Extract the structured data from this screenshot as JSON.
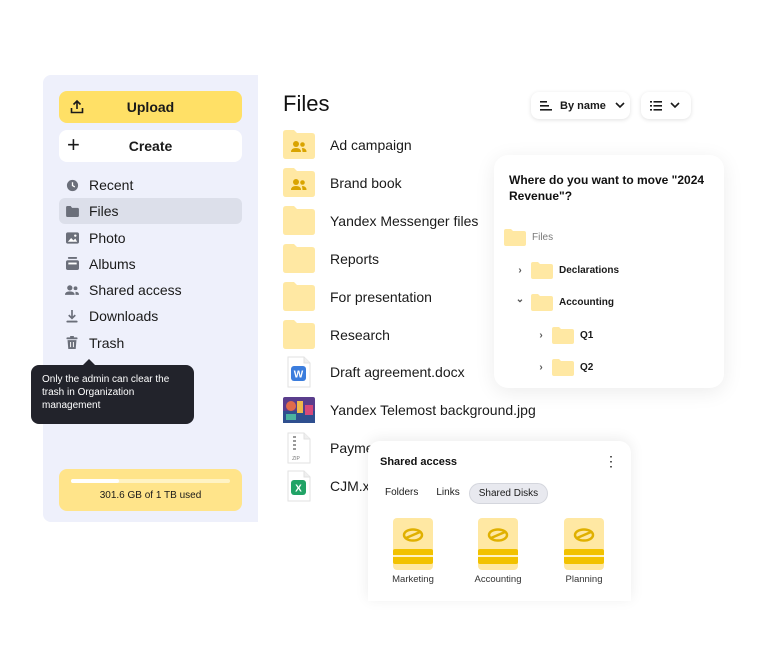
{
  "sidebar": {
    "upload_label": "Upload",
    "create_label": "Create",
    "items": [
      {
        "label": "Recent",
        "icon": "clock-icon"
      },
      {
        "label": "Files",
        "icon": "folder-icon"
      },
      {
        "label": "Photo",
        "icon": "image-icon"
      },
      {
        "label": "Albums",
        "icon": "album-icon"
      },
      {
        "label": "Shared access",
        "icon": "users-icon"
      },
      {
        "label": "Downloads",
        "icon": "download-icon"
      },
      {
        "label": "Trash",
        "icon": "trash-icon"
      }
    ],
    "active_item": "Files",
    "storage": {
      "text": "301.6 GB of 1 TB used",
      "used_fraction": 0.3
    }
  },
  "tooltip": {
    "text": "Only the admin can clear the trash in Organization management"
  },
  "main": {
    "title": "Files",
    "sort_label": "By name",
    "files": [
      {
        "name": "Ad campaign",
        "type": "shared-folder"
      },
      {
        "name": "Brand book",
        "type": "shared-folder"
      },
      {
        "name": "Yandex Messenger files",
        "type": "folder"
      },
      {
        "name": "Reports",
        "type": "folder"
      },
      {
        "name": "For presentation",
        "type": "folder"
      },
      {
        "name": "Research",
        "type": "folder"
      },
      {
        "name": "Draft agreement.docx",
        "type": "docx"
      },
      {
        "name": "Yandex Telemost background.jpg",
        "type": "jpg"
      },
      {
        "name": "Payme",
        "type": "zip"
      },
      {
        "name": "CJM.x",
        "type": "xlsx"
      }
    ]
  },
  "move_dialog": {
    "question": "Where do you want to move \"2024 Revenue\"?",
    "root": "Files",
    "tree": [
      {
        "label": "Declarations",
        "chevron": "›"
      },
      {
        "label": "Accounting",
        "chevron": "⌄"
      },
      {
        "label": "Q1",
        "chevron": "›"
      },
      {
        "label": "Q2",
        "chevron": "›"
      }
    ]
  },
  "shared_panel": {
    "title": "Shared access",
    "menu_glyph": "⋮",
    "tabs": [
      "Folders",
      "Links",
      "Shared Disks"
    ],
    "active_tab": "Shared Disks",
    "disks": [
      "Marketing",
      "Accounting",
      "Planning"
    ]
  },
  "docx_letter": "W",
  "xlsx_letter": "X",
  "zip_label": "ZIP",
  "colors": {
    "accent": "#ffe066",
    "sidebar_bg": "#eef0fb",
    "folder": "#ffe8a3",
    "tooltip_bg": "#22232b",
    "disk": "#f2c200"
  }
}
